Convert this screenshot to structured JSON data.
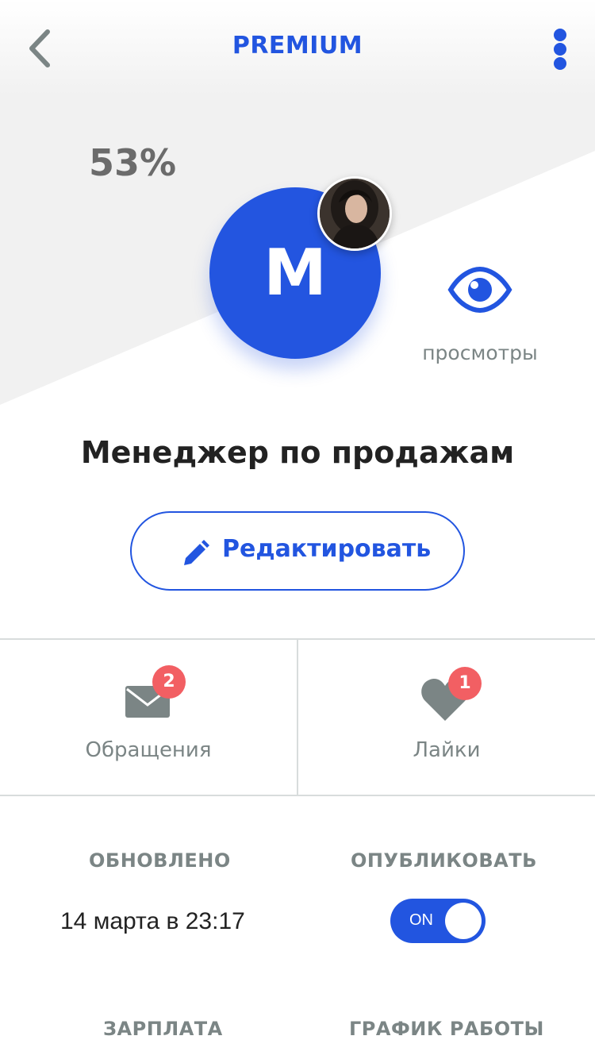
{
  "header": {
    "title": "PREMIUM",
    "back_icon": "chevron-left-icon",
    "more_icon": "more-vertical-icon"
  },
  "profile": {
    "completion": "53%",
    "completion_value": 0.53,
    "initial": "M",
    "views_label": "просмотры",
    "job_title": "Менеджер по продажам",
    "edit_label": "Редактировать"
  },
  "stats": {
    "messages": {
      "label": "Обращения",
      "badge": "2"
    },
    "likes": {
      "label": "Лайки",
      "badge": "1"
    }
  },
  "details": {
    "updated_label": "ОБНОВЛЕНО",
    "updated_value": "14 марта в 23:17",
    "publish_label": "ОПУБЛИКОВАТЬ",
    "publish_toggle": "ON",
    "salary_label": "ЗАРПЛАТА",
    "schedule_label": "ГРАФИК РАБОТЫ"
  },
  "colors": {
    "accent": "#2255e0",
    "badge": "#f25f63",
    "muted": "#7b8585",
    "hero_bg": "#f1f1f1"
  }
}
